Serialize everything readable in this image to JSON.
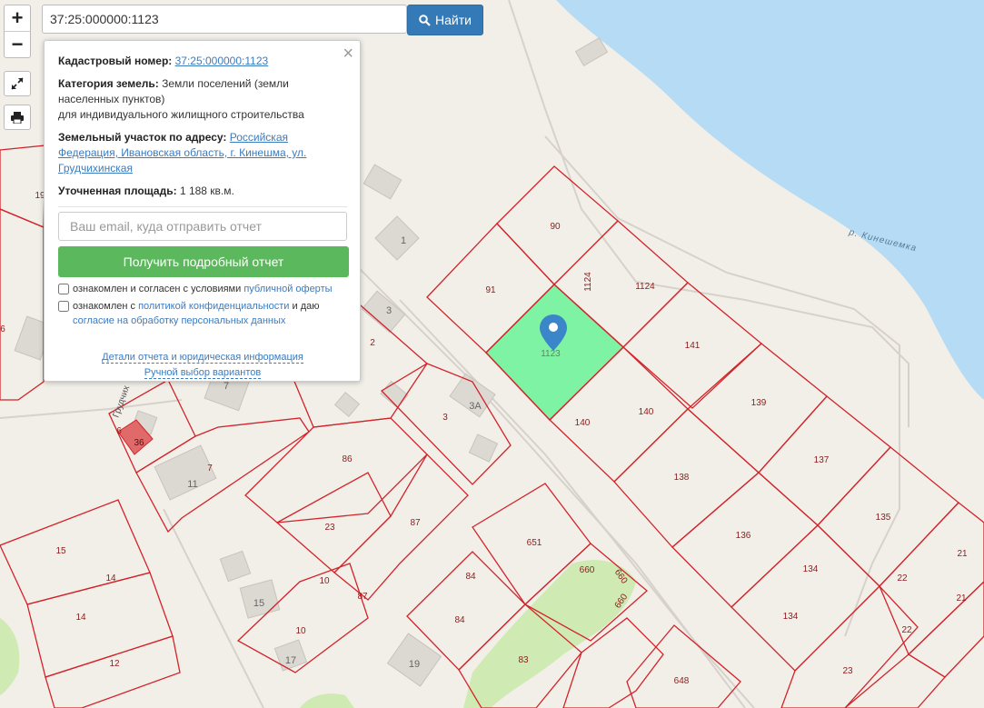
{
  "search": {
    "value": "37:25:000000:1123",
    "button_label": "Найти"
  },
  "controls": {
    "zoom_in": "+",
    "zoom_out": "−"
  },
  "popup": {
    "cadastral_label": "Кадастровый номер:",
    "cadastral_value": "37:25:000000:1123",
    "category_label": "Категория земель:",
    "category_value": "Земли поселений (земли населенных пунктов)",
    "category_use": "для индивидуального жилищного строительства",
    "address_label": "Земельный участок по адресу:",
    "address_value": "Российская Федерация, Ивановская область, г. Кинешма, ул. Грудчихинская",
    "area_label": "Уточненная площадь:",
    "area_value": "1 188 кв.м.",
    "email_placeholder": "Ваш email, куда отправить отчет",
    "report_button": "Получить подробный отчет",
    "agree1_text": "ознакомлен и согласен с условиями",
    "agree1_link": "публичной оферты",
    "agree2_text": "ознакомлен с",
    "agree2_link": "политикой конфиденциальности",
    "agree2_mid": "и даю",
    "agree2_link2": "согласие на обработку персональных данных",
    "details_link": "Детали отчета и юридическая информация",
    "manual_link": "Ручной выбор вариантов"
  },
  "map": {
    "river_label": "р. Кинешемка",
    "street_label": "Грудчих",
    "selected_parcel": "1123",
    "parcel_labels": [
      "90",
      "91",
      "1124",
      "141",
      "1123",
      "140",
      "140",
      "139",
      "138",
      "137",
      "136",
      "135",
      "134",
      "134",
      "21",
      "21",
      "22",
      "22",
      "23",
      "651",
      "660",
      "660",
      "660",
      "84",
      "84",
      "83",
      "648",
      "86",
      "87",
      "87",
      "23",
      "10",
      "10",
      "7",
      "6",
      "36",
      "11",
      "15",
      "14",
      "14",
      "12",
      "19",
      "2",
      "3",
      "3",
      "1",
      "3А",
      "15",
      "17",
      "19",
      "6",
      "7"
    ],
    "building_labels": [
      "1",
      "3",
      "3А",
      "7",
      "11",
      "15",
      "17",
      "19"
    ],
    "colors": {
      "parcel_border": "#d2232a",
      "selected_fill": "#7ef3a4",
      "water": "#b5dcf4",
      "land": "#f2efe9",
      "building": "#dcd8d2",
      "green": "#cfeab3",
      "highlight": "#e06a6a",
      "marker": "#3a86c8"
    }
  }
}
